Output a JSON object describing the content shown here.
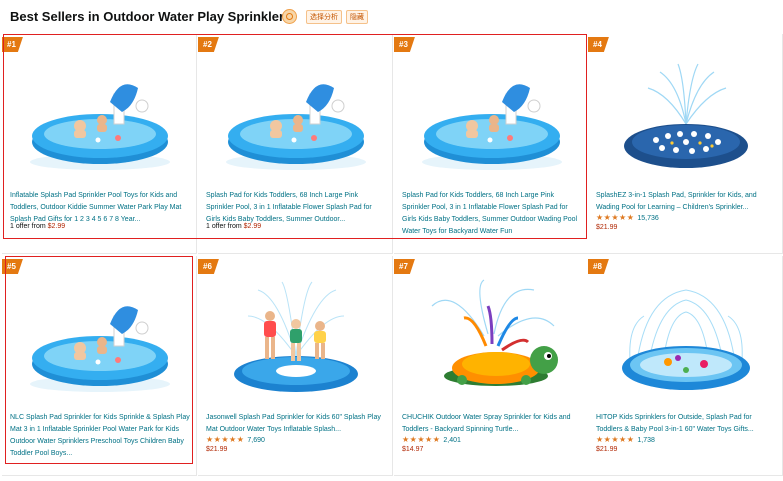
{
  "header": {
    "title": "Best Sellers in Outdoor Water Play Sprinklers",
    "tag1": "选择分析",
    "tag2": "隐藏"
  },
  "products": [
    {
      "rank": "#1",
      "title": "Inflatable Splash Pad Sprinkler Pool Toys for Kids and Toddlers, Outdoor Kiddie Summer Water Park Play Mat Splash Pad Gifts for 1 2 3 4 5 6 7 8 Year...",
      "offer_prefix": "1 offer from ",
      "price": "$2.99",
      "image": "inflatable-pool-image"
    },
    {
      "rank": "#2",
      "title": "Splash Pad for Kids Toddlers, 68 Inch Large Pink Sprinkler Pool, 3 in 1 Inflatable Flower Splash Pad for Girls Kids Baby Toddlers, Summer Outdoor...",
      "offer_prefix": "1 offer from ",
      "price": "$2.99",
      "image": "inflatable-pool-image"
    },
    {
      "rank": "#3",
      "title": "Splash Pad for Kids Toddlers, 68 Inch Large Pink Sprinkler Pool, 3 in 1 Inflatable Flower Splash Pad for Girls Kids Baby Toddlers, Summer Outdoor Wading Pool Water Toys for Backyard Water Fun",
      "image": "inflatable-pool-image"
    },
    {
      "rank": "#4",
      "title": "SplashEZ 3-in-1 Splash Pad, Sprinkler for Kids, and Wading Pool for Learning – Children's Sprinkler...",
      "stars": "★★★★★",
      "reviews": "15,736",
      "price": "$21.99",
      "image": "splash-mat-image"
    },
    {
      "rank": "#5",
      "title": "NLC Splash Pad Sprinkler for Kids Sprinkle & Splash Play Mat 3 in 1 Inflatable Sprinkler Pool Water Park for Kids Outdoor Water Sprinklers Preschool Toys Children Baby Toddler Pool Boys...",
      "image": "inflatable-pool-image"
    },
    {
      "rank": "#6",
      "title": "Jasonwell Splash Pad Sprinkler for Kids 60\" Splash Play Mat Outdoor Water Toys Inflatable Splash...",
      "stars": "★★★★★",
      "reviews": "7,690",
      "price": "$21.99",
      "image": "kids-splash-mat-image"
    },
    {
      "rank": "#7",
      "title": "CHUCHIK Outdoor Water Spray Sprinkler for Kids and Toddlers - Backyard Spinning Turtle...",
      "stars": "★★★★★",
      "reviews": "2,401",
      "price": "$14.97",
      "image": "turtle-sprinkler-image"
    },
    {
      "rank": "#8",
      "title": "HITOP Kids Sprinklers for Outside, Splash Pad for Toddlers & Baby Pool 3-in-1 60\" Water Toys Gifts...",
      "stars": "★★★★★",
      "reviews": "1,738",
      "price": "$21.99",
      "image": "fountain-splash-pad-image"
    }
  ],
  "colors": {
    "rank_badge": "#e47911",
    "link": "#007185",
    "price": "#b12704",
    "highlight": "#e02020",
    "pool_blue": "#29a3e6"
  }
}
